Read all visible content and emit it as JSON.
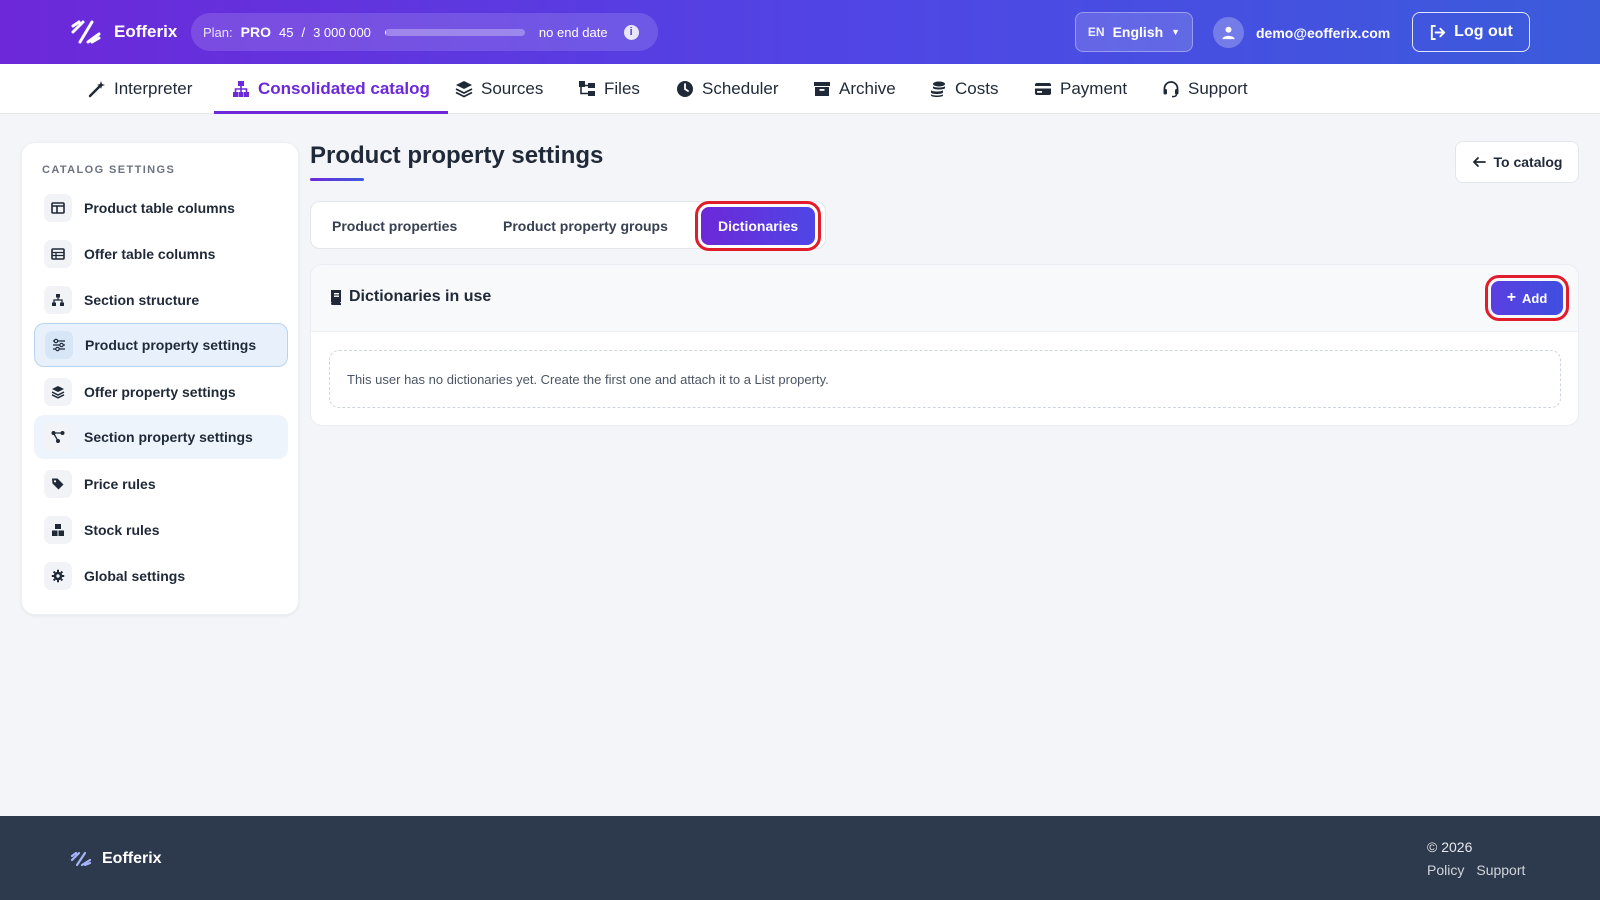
{
  "header": {
    "brand": "Eofferix",
    "plan": {
      "label": "Plan:",
      "tier": "PRO",
      "used": "45",
      "separator": "/",
      "limit": "3 000 000",
      "usage_fraction": 1.5e-05,
      "end": "no end date",
      "info_icon": "info-icon"
    },
    "language": {
      "code": "EN",
      "name": "English"
    },
    "user_email": "demo@eofferix.com",
    "logout_label": "Log out"
  },
  "nav": {
    "items": [
      {
        "label": "Interpreter",
        "icon": "wand-icon"
      },
      {
        "label": "Consolidated catalog",
        "icon": "sitemap-icon"
      },
      {
        "label": "Sources",
        "icon": "layers-icon"
      },
      {
        "label": "Files",
        "icon": "folder-tree-icon"
      },
      {
        "label": "Scheduler",
        "icon": "clock-icon"
      },
      {
        "label": "Archive",
        "icon": "archive-icon"
      },
      {
        "label": "Costs",
        "icon": "coins-icon"
      },
      {
        "label": "Payment",
        "icon": "credit-card-icon"
      },
      {
        "label": "Support",
        "icon": "headset-icon"
      }
    ],
    "active_index": 1
  },
  "sidebar": {
    "title": "CATALOG SETTINGS",
    "items": [
      {
        "label": "Product table columns",
        "icon": "columns-icon"
      },
      {
        "label": "Offer table columns",
        "icon": "table-icon"
      },
      {
        "label": "Section structure",
        "icon": "hierarchy-icon"
      },
      {
        "label": "Product property settings",
        "icon": "sliders-icon"
      },
      {
        "label": "Offer property settings",
        "icon": "layers-icon"
      },
      {
        "label": "Section property settings",
        "icon": "share-nodes-icon"
      },
      {
        "label": "Price rules",
        "icon": "tags-icon"
      },
      {
        "label": "Stock rules",
        "icon": "boxes-icon"
      },
      {
        "label": "Global settings",
        "icon": "gear-icon"
      }
    ],
    "active_index": 3
  },
  "main": {
    "title": "Product property settings",
    "back_label": "To catalog",
    "tabs": [
      {
        "label": "Product properties"
      },
      {
        "label": "Product property groups"
      },
      {
        "label": "Dictionaries"
      }
    ],
    "active_tab": 2,
    "panel": {
      "title": "Dictionaries in use",
      "add_label": "Add",
      "empty_text": "This user has no dictionaries yet. Create the first one and attach it to a List property."
    }
  },
  "footer": {
    "brand": "Eofferix",
    "copyright": "© 2026",
    "links": [
      "Policy",
      "Support"
    ]
  },
  "colors": {
    "accent": "#6d28d9",
    "header_gradient_start": "#6d28d9",
    "header_gradient_end": "#3b5bdb",
    "highlight_outline": "#e21d2b",
    "footer_bg": "#2d3a4d"
  }
}
